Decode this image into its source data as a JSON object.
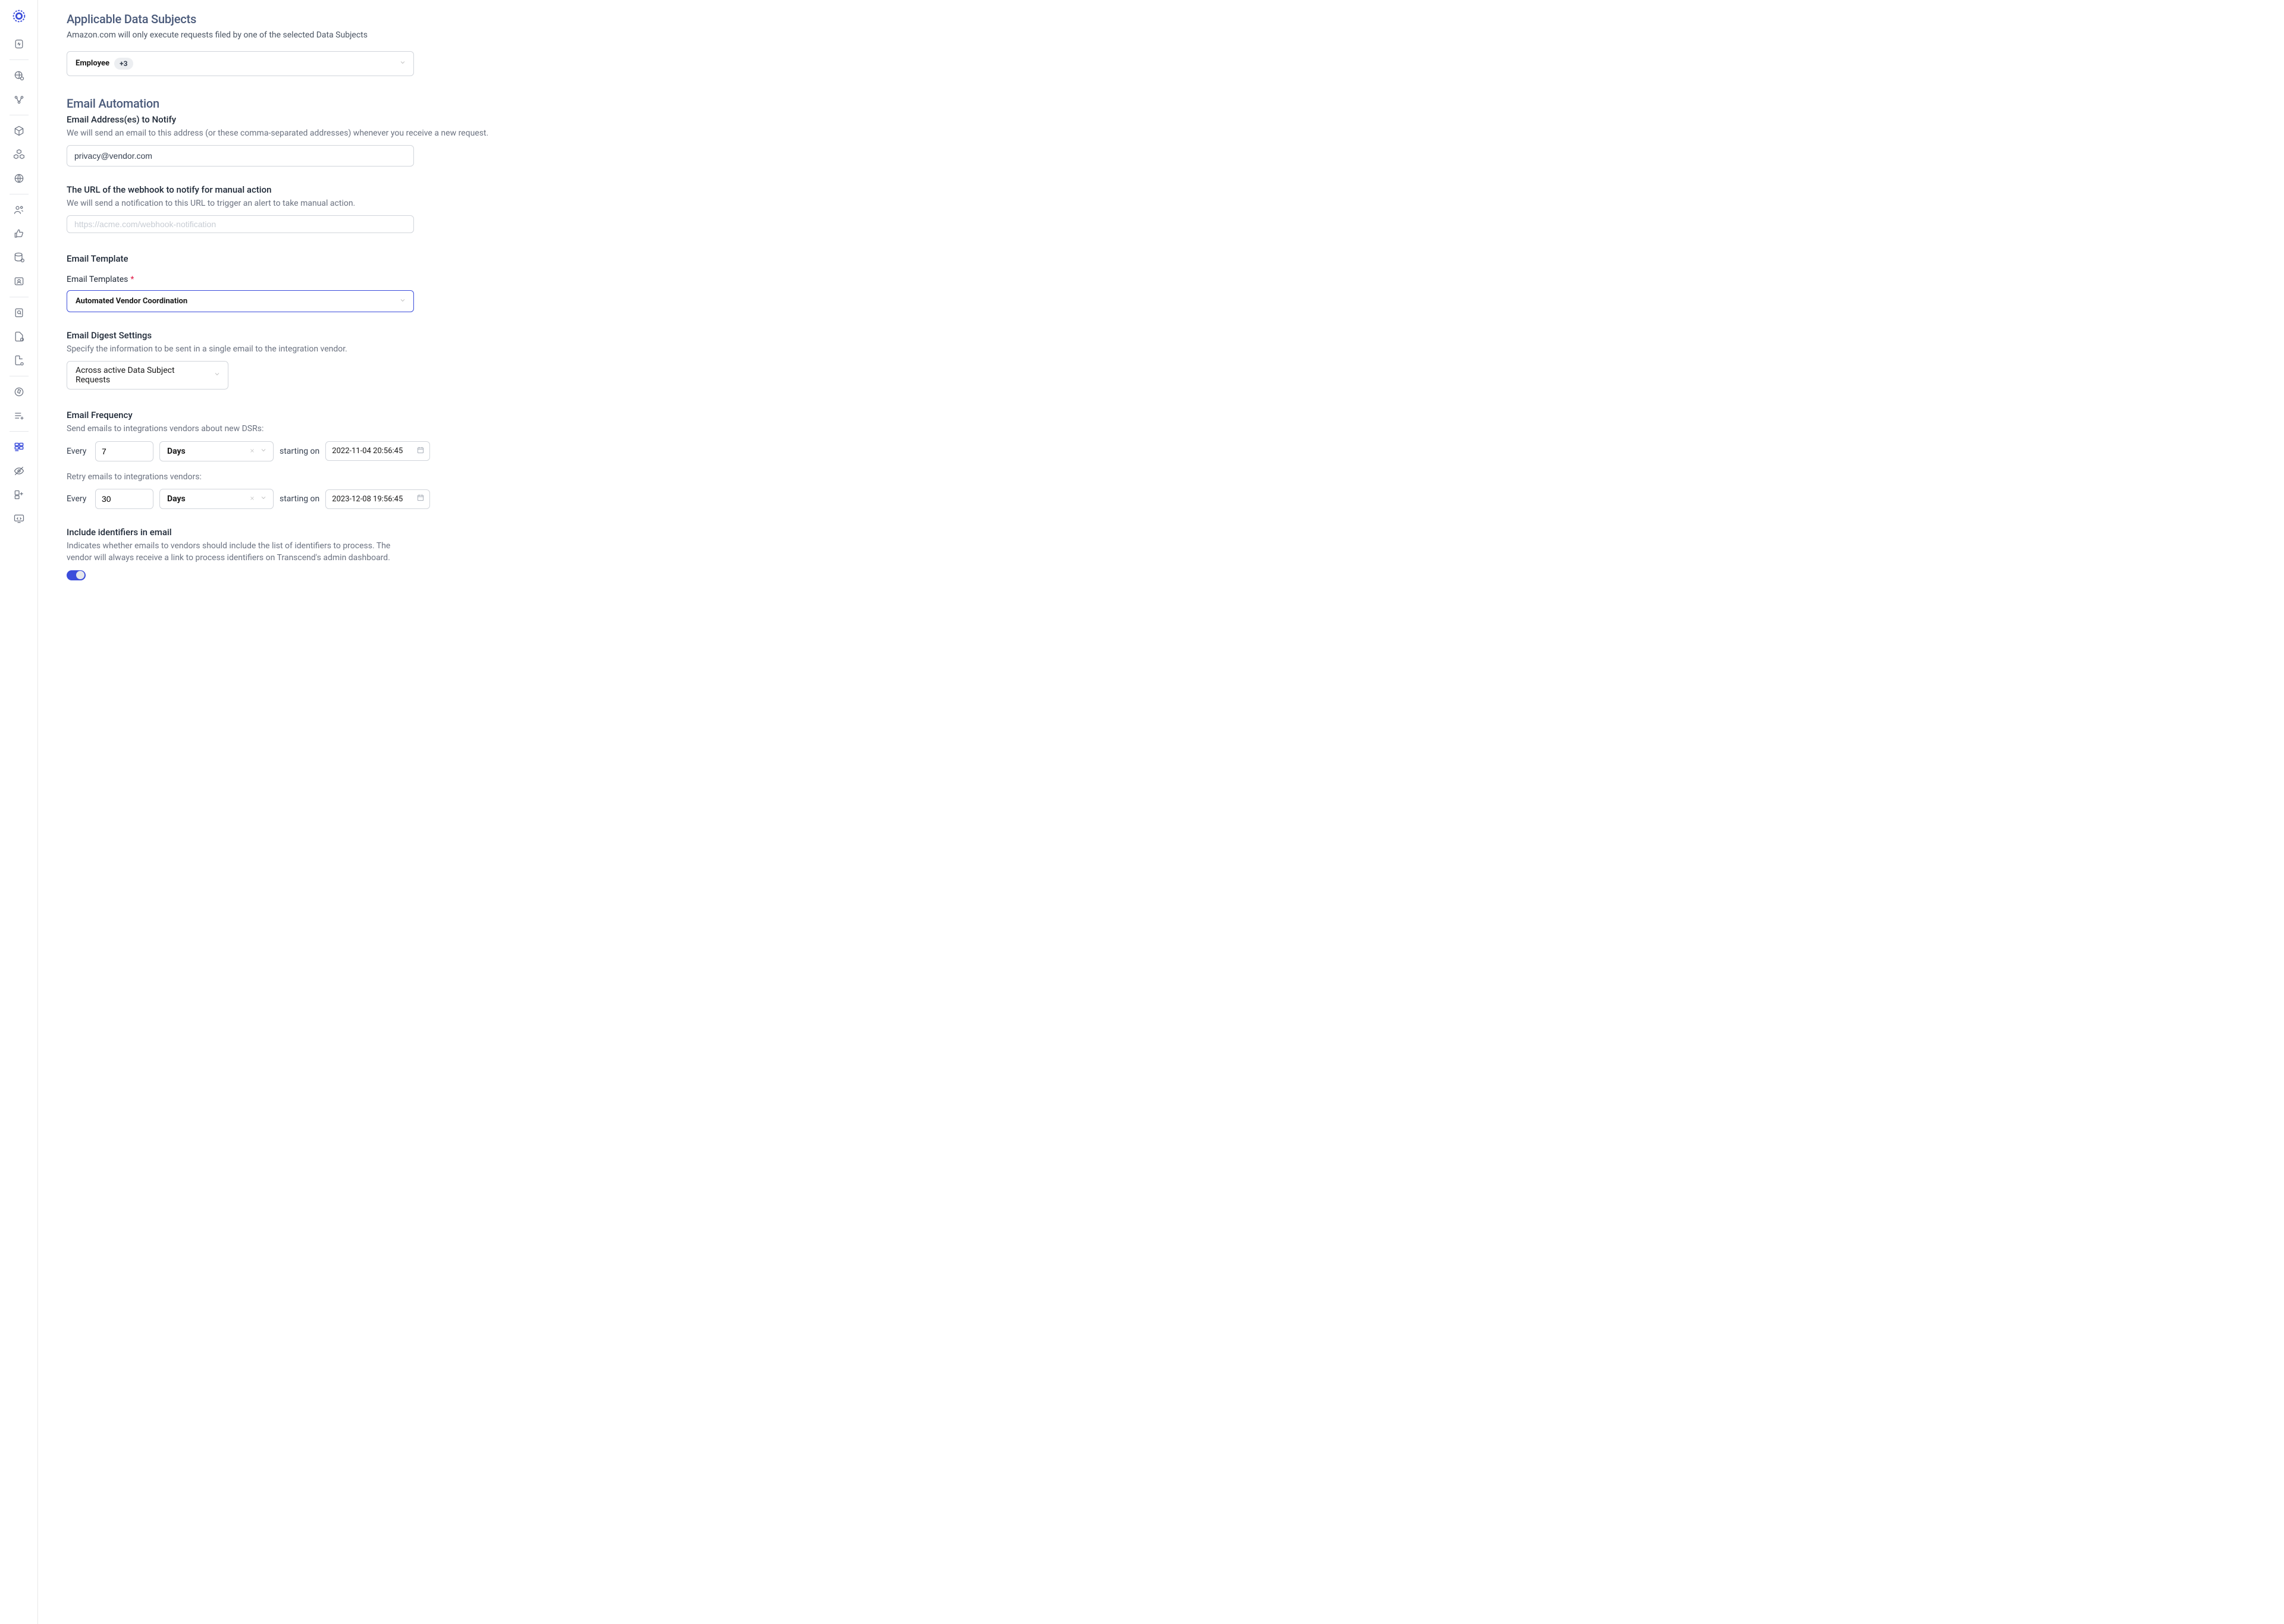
{
  "sections": {
    "data_subjects": {
      "title": "Applicable Data Subjects",
      "desc": "Amazon.com will only execute requests filed by one of the selected Data Subjects",
      "selected_label": "Employee",
      "extra_count": "+3"
    },
    "email_automation": {
      "title": "Email Automation"
    },
    "notify_email": {
      "title": "Email Address(es) to Notify",
      "desc": "We will send an email to this address (or these comma-separated addresses) whenever you receive a new request.",
      "value": "privacy@vendor.com"
    },
    "webhook": {
      "title": "The URL of the webhook to notify for manual action",
      "desc": "We will send a notification to this URL to trigger an alert to take manual action.",
      "placeholder": "https://acme.com/webhook-notification"
    },
    "template": {
      "title": "Email Template",
      "field_label": "Email Templates",
      "selected": "Automated Vendor Coordination"
    },
    "digest": {
      "title": "Email Digest Settings",
      "desc": "Specify the information to be sent in a single email to the integration vendor.",
      "selected": "Across active Data Subject Requests"
    },
    "frequency": {
      "title": "Email Frequency",
      "send_desc": "Send emails to integrations vendors about new DSRs:",
      "retry_desc": "Retry emails to integrations vendors:",
      "every_label": "Every",
      "starting_label": "starting on",
      "send": {
        "value": "7",
        "unit": "Days",
        "date": "2022-11-04 20:56:45"
      },
      "retry": {
        "value": "30",
        "unit": "Days",
        "date": "2023-12-08 19:56:45"
      }
    },
    "identifiers": {
      "title": "Include identifiers in email",
      "desc": "Indicates whether emails to vendors should include the list of identifiers to process. The vendor will always receive a link to process identifiers on Transcend's admin dashboard."
    }
  }
}
